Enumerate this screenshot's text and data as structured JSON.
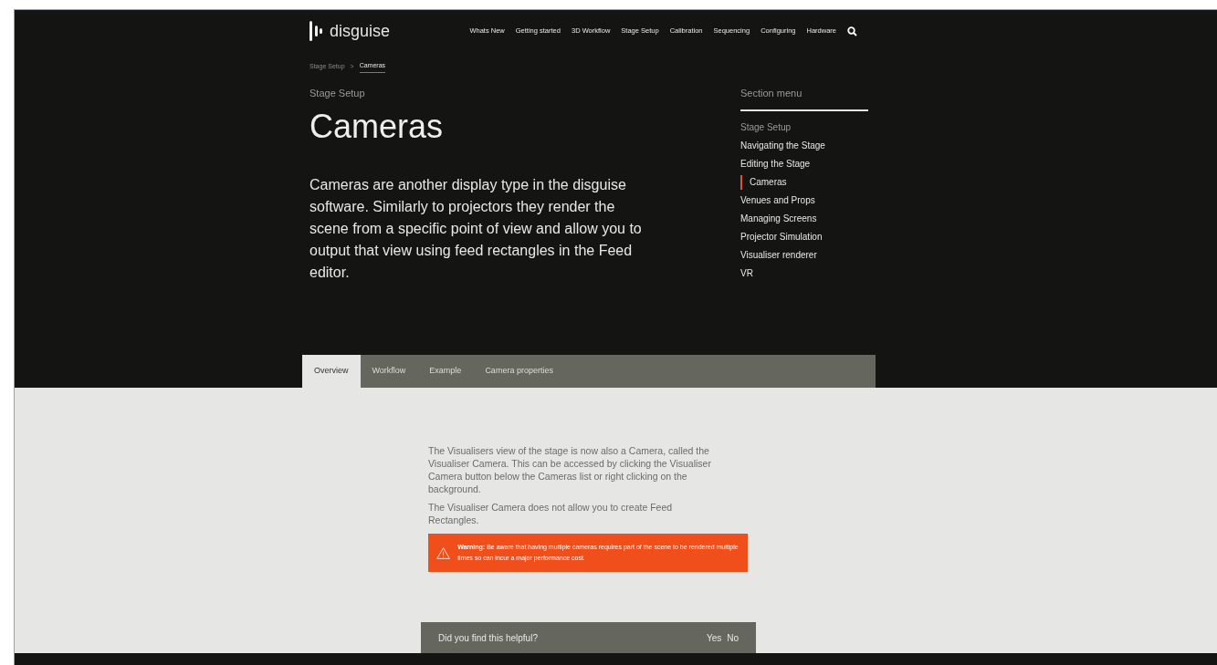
{
  "header": {
    "logo": "disguise",
    "nav": [
      "Whats New",
      "Getting started",
      "3D Workflow",
      "Stage Setup",
      "Calibration",
      "Sequencing",
      "Configuring",
      "Hardware"
    ]
  },
  "breadcrumb": [
    {
      "label": "Stage Setup",
      "current": false
    },
    {
      "label": ">",
      "current": false
    },
    {
      "label": "Cameras",
      "current": true
    }
  ],
  "section": "Stage Setup",
  "title": "Cameras",
  "intro": "Cameras are another display type in the disguise software. Similarly to projectors they render the scene from a specific point of view and allow you to output that view using feed rectangles in the Feed editor.",
  "section_menu": {
    "title": "Section menu",
    "items": [
      {
        "label": "Stage Setup",
        "kind": "parent",
        "selected": false
      },
      {
        "label": "Navigating the Stage",
        "kind": "page",
        "selected": false
      },
      {
        "label": "Editing the Stage",
        "kind": "page",
        "selected": false
      },
      {
        "label": "Cameras",
        "kind": "page",
        "selected": true
      },
      {
        "label": "Venues and Props",
        "kind": "page",
        "selected": false
      },
      {
        "label": "Managing Screens",
        "kind": "page",
        "selected": false
      },
      {
        "label": "Projector Simulation",
        "kind": "page",
        "selected": false
      },
      {
        "label": "Visualiser renderer",
        "kind": "page",
        "selected": false
      },
      {
        "label": "VR",
        "kind": "page",
        "selected": false
      }
    ]
  },
  "tabs": [
    {
      "label": "Overview",
      "selected": true
    },
    {
      "label": "Workflow",
      "selected": false
    },
    {
      "label": "Example",
      "selected": false
    },
    {
      "label": "Camera properties",
      "selected": false
    }
  ],
  "paragraphs": [
    "The Visualisers view of the stage is now also a Camera, called the Visualiser Camera. This can be accessed by clicking the Visualiser Camera button below the Cameras list or right clicking on the background.",
    "The Visualiser Camera does not allow you to create Feed Rectangles."
  ],
  "warning": "**Warning:** Be aware that having multiple cameras requires part of the scene to be rendered multiple times so can incur a major performance cost.",
  "feedback": {
    "question": "Did you find this helpful?",
    "answers": [
      "Yes",
      "No"
    ]
  }
}
